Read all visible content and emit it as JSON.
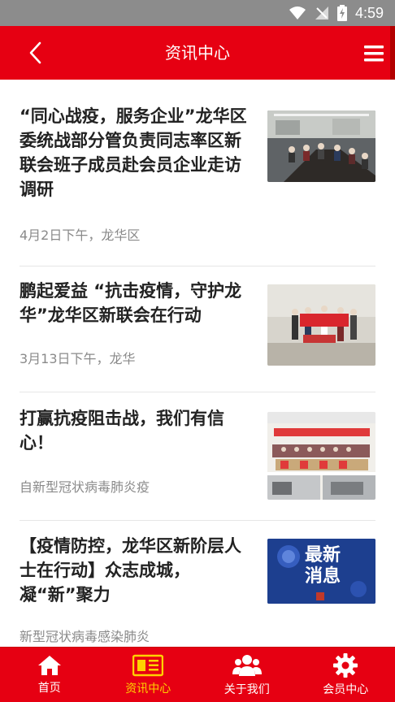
{
  "status_bar": {
    "time": "4:59"
  },
  "header": {
    "title": "资讯中心"
  },
  "articles": [
    {
      "title": "“同心战疫，服务企业”龙华区委统战部分管负责同志率区新联会班子成员赴会员企业走访调研",
      "meta": "4月2日下午，龙华区"
    },
    {
      "title": "鹏起爱益 “抗击疫情，守护龙华”龙华区新联会在行动",
      "meta": "3月13日下午，龙华"
    },
    {
      "title": "打赢抗疫阻击战，我们有信心！",
      "meta": "自新型冠状病毒肺炎疫"
    },
    {
      "title": "【疫情防控，龙华区新阶层人士在行动】众志成城，凝“新”聚力",
      "meta": "新型冠状病毒感染肺炎",
      "thumb_text": "最新消息"
    }
  ],
  "tabs": [
    {
      "label": "首页",
      "icon": "home-icon"
    },
    {
      "label": "资讯中心",
      "icon": "news-icon",
      "active": true
    },
    {
      "label": "关于我们",
      "icon": "people-icon"
    },
    {
      "label": "会员中心",
      "icon": "gear-icon"
    }
  ],
  "colors": {
    "primary": "#e60012",
    "active_tab": "#ffd200",
    "status_bar": "#8c8c8c"
  }
}
